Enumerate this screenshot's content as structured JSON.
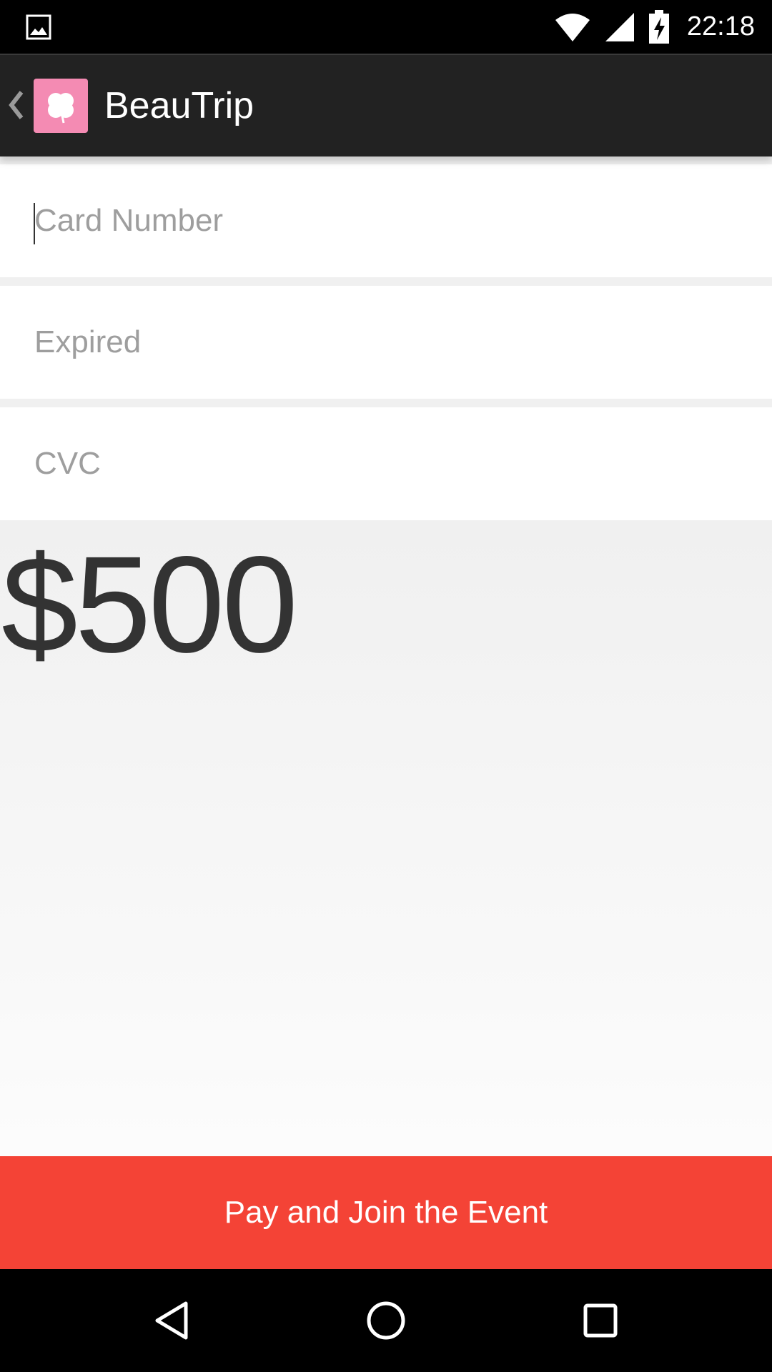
{
  "status_bar": {
    "time": "22:18",
    "icons": [
      "gallery-icon",
      "wifi-icon",
      "cell-signal-icon",
      "battery-charging-icon"
    ]
  },
  "action_bar": {
    "title": "BeauTrip",
    "up_icon": "chevron-left-icon",
    "app_icon": "clover-icon",
    "app_icon_color": "#f48bb3",
    "background": "#222222"
  },
  "form": {
    "card_number": {
      "placeholder": "Card Number",
      "value": ""
    },
    "expired": {
      "placeholder": "Expired",
      "value": ""
    },
    "cvc": {
      "placeholder": "CVC",
      "value": ""
    }
  },
  "price": "$500",
  "pay_button": {
    "label": "Pay and Join the Event",
    "color": "#f44336"
  },
  "nav_bar": {
    "icons": [
      "back-triangle-icon",
      "home-circle-icon",
      "recents-square-icon"
    ]
  }
}
